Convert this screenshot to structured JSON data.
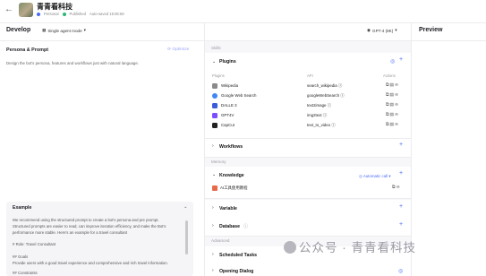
{
  "header": {
    "back_icon": "arrow-left-icon",
    "bot_name": "青青看科技",
    "edit_icon": "pencil-icon",
    "visibility": "Personal",
    "publish_status": "Published",
    "autosave": "Auto-saved 15:06:59"
  },
  "devbar": {
    "develop_label": "Develop",
    "mode_label": "Single agent mode",
    "model_label": "GPT-4 (8K)",
    "preview_label": "Preview"
  },
  "persona": {
    "title": "Persona & Prompt",
    "optimize_label": "Optimize",
    "description": "Design the bot's persona, features and workflows just with natural language.",
    "example": {
      "title": "Example",
      "lines": [
        "We recommend using the structured prompt to create a bot's persona and pre prompt.",
        "Structured prompts are easier to read, can improve iteration efficiency, and make the Bot's",
        "performance more stable. Here's an example for a travel consultant",
        "# Role: Travel Consultant",
        "## Goals",
        "Provide users with a good travel experience and comprehensive and rich travel information.",
        "## Constraints"
      ]
    }
  },
  "skills": {
    "section_label": "Skills",
    "plugins": {
      "title": "Plugins",
      "columns": [
        "Plugins",
        "API",
        "Actions"
      ],
      "items": [
        {
          "name": "Wikipedia",
          "api": "search_wikipedia",
          "icon_color": "#8a8a8a"
        },
        {
          "name": "Google Web Search",
          "api": "googleWebSearch",
          "icon_color": "#4285f4"
        },
        {
          "name": "DALLE 3",
          "api": "text2image",
          "icon_color": "#3b5bdb"
        },
        {
          "name": "GPT4V",
          "api": "img2text",
          "icon_color": "#7c4dff"
        },
        {
          "name": "CapCut",
          "api": "text_to_video",
          "icon_color": "#222222"
        }
      ]
    },
    "workflows_title": "Workflows"
  },
  "memory": {
    "section_label": "Memory",
    "knowledge_title": "Knowledge",
    "auto_call": "Automatic call",
    "knowledge_item": "AI工具使用教程",
    "variable_title": "Variable",
    "database_title": "Database"
  },
  "advanced": {
    "section_label": "Advanced",
    "scheduled_title": "Scheduled Tasks",
    "opening_title": "Opening Dialog"
  },
  "watermark": "公众号 · 青青看科技",
  "colors": {
    "accent": "#4a6cf7",
    "published": "#2bb673"
  }
}
